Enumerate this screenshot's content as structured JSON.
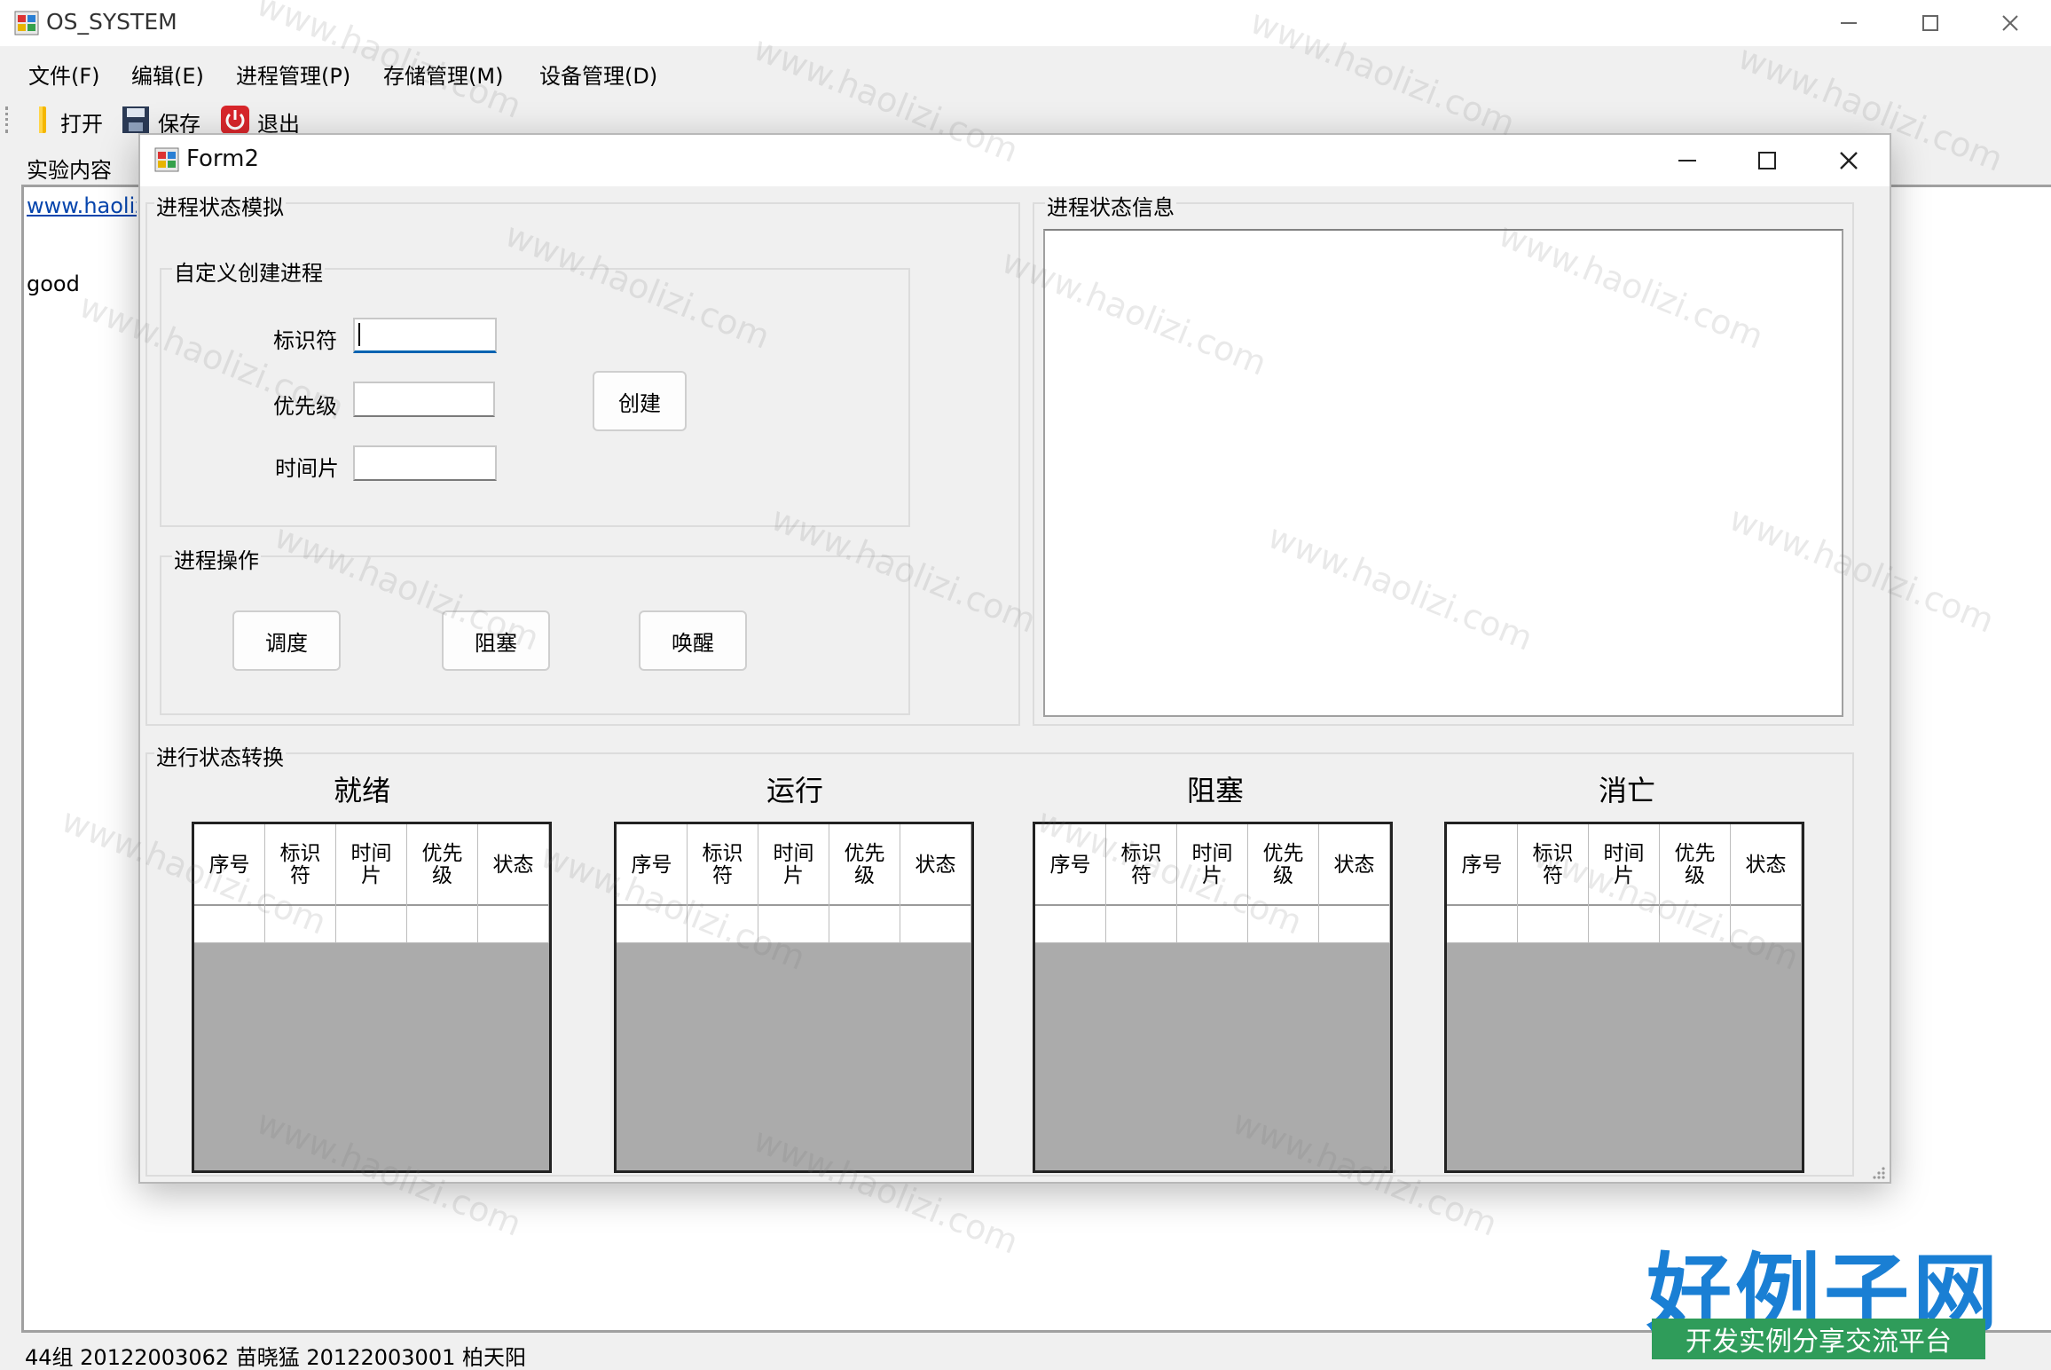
{
  "main_window": {
    "title": "OS_SYSTEM",
    "menu": [
      "文件(F)",
      "编辑(E)",
      "进程管理(P)",
      "存储管理(M)",
      "设备管理(D)"
    ],
    "toolbar": {
      "open": "打开",
      "save": "保存",
      "exit": "退出"
    },
    "experiment_label": "实验内容",
    "content_link": "www.haolizi.com",
    "content_text": "good",
    "status_text": "44组 20122003062 苗晓猛 20122003001 柏天阳"
  },
  "form2": {
    "title": "Form2",
    "process_sim": {
      "group_title": "进程状态模拟",
      "create_group": {
        "title": "自定义创建进程",
        "id_label": "标识符",
        "id_value": "",
        "priority_label": "优先级",
        "priority_value": "",
        "timeslice_label": "时间片",
        "timeslice_value": "",
        "create_button": "创建"
      },
      "ops_group": {
        "title": "进程操作",
        "schedule_button": "调度",
        "block_button": "阻塞",
        "wake_button": "唤醒"
      }
    },
    "info_group": {
      "title": "进程状态信息",
      "content": ""
    },
    "transition_group": {
      "title": "进行状态转换",
      "columns": [
        "序号",
        "标识符",
        "时间片",
        "优先级",
        "状态"
      ],
      "queues": [
        {
          "title": "就绪"
        },
        {
          "title": "运行"
        },
        {
          "title": "阻塞"
        },
        {
          "title": "消亡"
        }
      ]
    }
  },
  "watermark": {
    "text": "www.haolizi.com",
    "brand": "好例子网",
    "brand_sub": "开发实例分享交流平台"
  },
  "colors": {
    "link": "#0645ad",
    "grid_empty": "#ababab",
    "brand_blue": "#1a7fd4",
    "brand_green": "#2f9c5a",
    "focus_blue": "#0063b1"
  }
}
